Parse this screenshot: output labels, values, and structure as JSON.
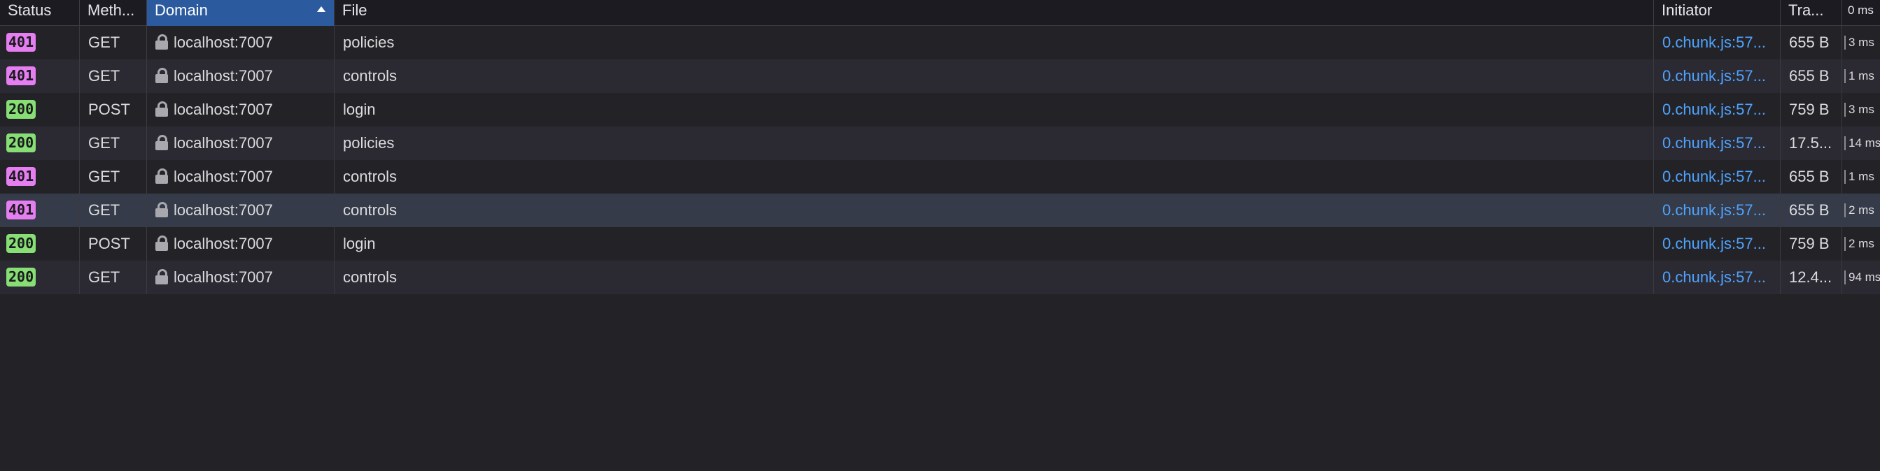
{
  "columns": {
    "status": "Status",
    "method": "Meth...",
    "domain": "Domain",
    "file": "File",
    "initiator": "Initiator",
    "transferred": "Tra...",
    "waterfall": "0 ms"
  },
  "colors": {
    "badge_4xx": "#e57ef0",
    "badge_2xx": "#86de74",
    "initiator_link": "#4fa3ff",
    "sorted_header": "#2b5b9e",
    "selected_row": "#353b48"
  },
  "rows": [
    {
      "status": "401",
      "method": "GET",
      "domain": "localhost:7007",
      "file": "policies",
      "initiator": "0.chunk.js:57...",
      "transferred": "655 B",
      "timing": "3 ms"
    },
    {
      "status": "401",
      "method": "GET",
      "domain": "localhost:7007",
      "file": "controls",
      "initiator": "0.chunk.js:57...",
      "transferred": "655 B",
      "timing": "1 ms"
    },
    {
      "status": "200",
      "method": "POST",
      "domain": "localhost:7007",
      "file": "login",
      "initiator": "0.chunk.js:57...",
      "transferred": "759 B",
      "timing": "3 ms"
    },
    {
      "status": "200",
      "method": "GET",
      "domain": "localhost:7007",
      "file": "policies",
      "initiator": "0.chunk.js:57...",
      "transferred": "17.5...",
      "timing": "14 ms"
    },
    {
      "status": "401",
      "method": "GET",
      "domain": "localhost:7007",
      "file": "controls",
      "initiator": "0.chunk.js:57...",
      "transferred": "655 B",
      "timing": "1 ms"
    },
    {
      "status": "401",
      "method": "GET",
      "domain": "localhost:7007",
      "file": "controls",
      "initiator": "0.chunk.js:57...",
      "transferred": "655 B",
      "timing": "2 ms",
      "selected": true
    },
    {
      "status": "200",
      "method": "POST",
      "domain": "localhost:7007",
      "file": "login",
      "initiator": "0.chunk.js:57...",
      "transferred": "759 B",
      "timing": "2 ms"
    },
    {
      "status": "200",
      "method": "GET",
      "domain": "localhost:7007",
      "file": "controls",
      "initiator": "0.chunk.js:57...",
      "transferred": "12.4...",
      "timing": "94 ms"
    }
  ]
}
